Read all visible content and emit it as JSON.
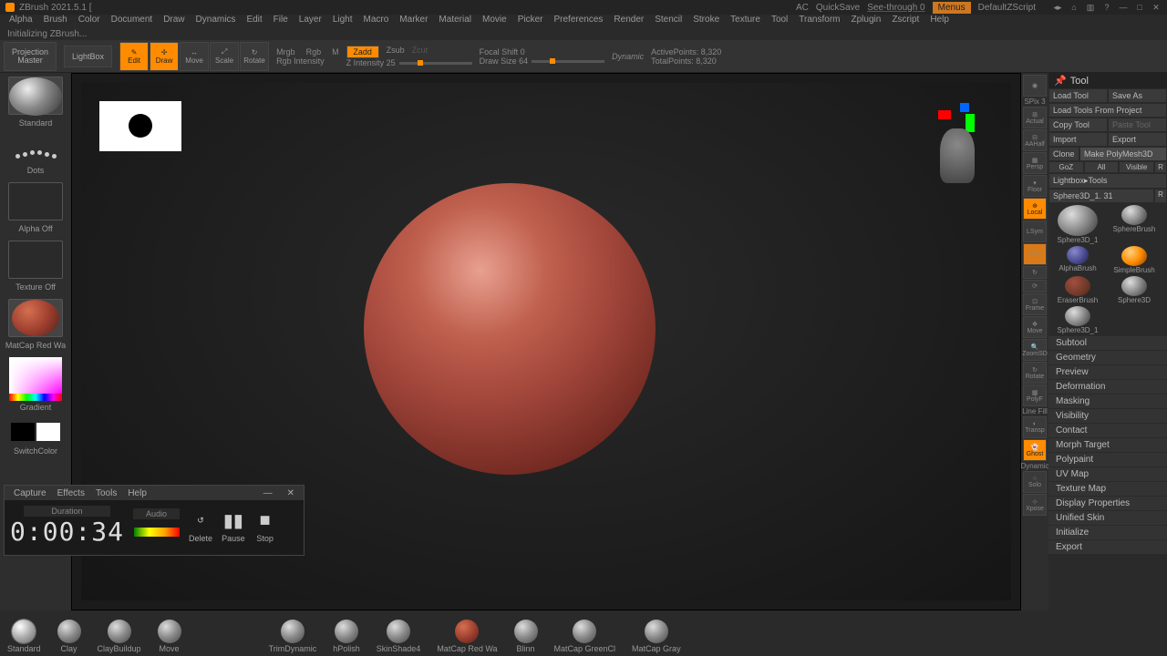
{
  "titlebar": {
    "title": "ZBrush 2021.5.1 [",
    "ac": "AC",
    "quicksave": "QuickSave",
    "seethrough": "See-through  0",
    "menus": "Menus",
    "defaultscript": "DefaultZScript"
  },
  "menubar": [
    "Alpha",
    "Brush",
    "Color",
    "Document",
    "Draw",
    "Dynamics",
    "Edit",
    "File",
    "Layer",
    "Light",
    "Macro",
    "Marker",
    "Material",
    "Movie",
    "Picker",
    "Preferences",
    "Render",
    "Stencil",
    "Stroke",
    "Texture",
    "Tool",
    "Transform",
    "Zplugin",
    "Zscript",
    "Help"
  ],
  "status": "Initializing ZBrush...",
  "shelf": {
    "projection": "Projection\nMaster",
    "lightbox": "LightBox",
    "edit": "Edit",
    "draw": "Draw",
    "move": "Move",
    "scale": "Scale",
    "rotate": "Rotate",
    "mrgb": "Mrgb",
    "rgb": "Rgb",
    "m": "M",
    "rgbint": "Rgb Intensity",
    "zadd": "Zadd",
    "zsub": "Zsub",
    "zcut": "Zcut",
    "zint": "Z Intensity 25",
    "focal": "Focal Shift 0",
    "drawsize": "Draw Size 64",
    "dynamic": "Dynamic",
    "active": "ActivePoints: 8,320",
    "total": "TotalPoints: 8,320"
  },
  "left": {
    "brush": "Standard",
    "stroke": "Dots",
    "alpha": "Alpha Off",
    "texture": "Texture Off",
    "material": "MatCap Red Wa",
    "gradient": "Gradient",
    "switchcolor": "SwitchColor"
  },
  "rightstrip": {
    "spix": "SPix 3",
    "items": [
      "BPR",
      "Actual",
      "AAHalf",
      "Persp",
      "Floor",
      "Local",
      "LSym",
      "XYZ",
      "Frame",
      "Move",
      "ZoomSD",
      "Rotate",
      "PolyF",
      "Line Fill",
      "Transp",
      "Ghost",
      "Dynamic",
      "Solo",
      "Xpose"
    ]
  },
  "tool": {
    "header": "Tool",
    "loadtool": "Load Tool",
    "saveas": "Save As",
    "loadproject": "Load Tools From Project",
    "copytool": "Copy Tool",
    "pastetool": "Paste Tool",
    "import": "Import",
    "export": "Export",
    "clone": "Clone",
    "makepoly": "Make PolyMesh3D",
    "goz": "GoZ",
    "all": "All",
    "visible": "Visible",
    "r1": "R",
    "lightbox": "Lightbox▸Tools",
    "sphere31": "Sphere3D_1. 31",
    "r2": "R",
    "tools": [
      {
        "name": "Sphere3D_1"
      },
      {
        "name": "SphereBrush"
      },
      {
        "name": "AlphaBrush"
      },
      {
        "name": "SimpleBrush"
      },
      {
        "name": "EraserBrush"
      },
      {
        "name": "Sphere3D"
      },
      {
        "name": "Sphere3D_1"
      }
    ],
    "sections": [
      "Subtool",
      "Geometry",
      "Preview",
      "Deformation",
      "Masking",
      "Visibility",
      "Contact",
      "Morph Target",
      "Polypaint",
      "UV Map",
      "Texture Map",
      "Display Properties",
      "Unified Skin",
      "Initialize",
      "Export"
    ]
  },
  "brushes": [
    "Standard",
    "Clay",
    "ClayBuildup",
    "Move",
    "",
    "TrimDynamic",
    "hPolish",
    "SkinShade4",
    "MatCap Red Wa",
    "Blinn",
    "MatCap GreenCl",
    "MatCap Gray"
  ],
  "recorder": {
    "menu": [
      "Capture",
      "Effects",
      "Tools",
      "Help"
    ],
    "duration_lbl": "Duration",
    "audio_lbl": "Audio",
    "time": "0:00:34",
    "delete": "Delete",
    "pause": "Pause",
    "stop": "Stop"
  }
}
